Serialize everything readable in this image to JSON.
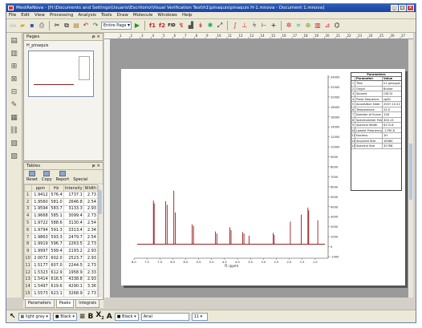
{
  "window": {
    "title": "MestReNova - [H:\\Documents and Settings\\Usuario\\Escritorio\\Visual Verification Test\\h1\\pinaquis\\pinaquis H-1.mnova - Document 1.mnova]"
  },
  "menu": [
    "File",
    "Edit",
    "View",
    "Processing",
    "Analysis",
    "Tools",
    "Draw",
    "Molecule",
    "Windows",
    "Help"
  ],
  "toolbar": {
    "page_select": "Entire Page"
  },
  "pages_panel": {
    "title": "Pages",
    "item_label": "H_pinaquis"
  },
  "tables_panel": {
    "title": "Tables",
    "tools": [
      "Reset",
      "Copy",
      "Report",
      "Special"
    ],
    "columns": [
      "ppm",
      "Hz",
      "Intensity",
      "Width"
    ],
    "rows": [
      [
        "1",
        "1.9412",
        "576.4",
        "1737.1",
        "2.73"
      ],
      [
        "2",
        "1.9560",
        "581.0",
        "2646.8",
        "2.54"
      ],
      [
        "3",
        "1.9594",
        "583.7",
        "3133.3",
        "2.93"
      ],
      [
        "4",
        "1.9668",
        "585.1",
        "3099.4",
        "2.73"
      ],
      [
        "5",
        "1.9722",
        "588.6",
        "3130.4",
        "2.54"
      ],
      [
        "6",
        "1.9794",
        "591.3",
        "3313.4",
        "2.34"
      ],
      [
        "7",
        "1.9863",
        "593.3",
        "2479.7",
        "2.54"
      ],
      [
        "8",
        "1.9919",
        "596.7",
        "2263.5",
        "2.73"
      ],
      [
        "9",
        "1.9997",
        "599.4",
        "2193.2",
        "2.93"
      ],
      [
        "10",
        "2.0072",
        "602.0",
        "2523.7",
        "2.93"
      ],
      [
        "11",
        "1.5177",
        "607.0",
        "2244.5",
        "2.73"
      ],
      [
        "12",
        "1.5323",
        "612.9",
        "1958.9",
        "2.33"
      ],
      [
        "13",
        "1.5414",
        "616.5",
        "4338.8",
        "2.93"
      ],
      [
        "14",
        "1.5497",
        "619.6",
        "4290.1",
        "3.36"
      ],
      [
        "15",
        "1.5573",
        "623.1",
        "3268.9",
        "2.73"
      ]
    ]
  },
  "bottom_tabs": [
    "Parameters",
    "Peaks",
    "Integrals"
  ],
  "statusbar": {
    "fill": "light gray",
    "line": "Black",
    "text_color": "Black",
    "font": "Arial",
    "font_size": "11"
  },
  "ruler_labels": [
    "1",
    "2",
    "3",
    "4",
    "5",
    "6",
    "7",
    "8",
    "9",
    "10",
    "11",
    "12",
    "13",
    "14",
    "15",
    "16",
    "17",
    "18",
    "19",
    "20",
    "21",
    "22",
    "23",
    "24",
    "25",
    "26",
    "27"
  ],
  "chart_data": {
    "type": "line",
    "xlabel": "f1 (ppm)",
    "x_reversed": true,
    "xlim": [
      8.0,
      0.5
    ],
    "x_ticks": [
      "8.0",
      "7.5",
      "7.0",
      "6.5",
      "6.0",
      "5.5",
      "5.0",
      "4.5",
      "4.0",
      "3.5",
      "3.0",
      "2.5",
      "2.0",
      "1.5",
      "1.0"
    ],
    "ylim": [
      -2000,
      24000
    ],
    "y_ticks": [
      "24000",
      "22000",
      "20000",
      "18000",
      "16000",
      "14000",
      "12000",
      "10000",
      "9000",
      "8000",
      "7000",
      "6000",
      "5000",
      "4000",
      "3000",
      "2000",
      "1000",
      "0",
      "-1000"
    ],
    "line_color": "#8b0000",
    "peaks": [
      {
        "x": 7.25,
        "y": 6200
      },
      {
        "x": 7.22,
        "y": 5800
      },
      {
        "x": 6.78,
        "y": 6100
      },
      {
        "x": 6.72,
        "y": 5600
      },
      {
        "x": 6.46,
        "y": 7600
      },
      {
        "x": 6.4,
        "y": 4500
      },
      {
        "x": 5.75,
        "y": 2800
      },
      {
        "x": 5.7,
        "y": 2600
      },
      {
        "x": 4.85,
        "y": 1800
      },
      {
        "x": 4.8,
        "y": 1500
      },
      {
        "x": 4.3,
        "y": 2400
      },
      {
        "x": 4.25,
        "y": 2000
      },
      {
        "x": 3.8,
        "y": 1700
      },
      {
        "x": 3.75,
        "y": 1500
      },
      {
        "x": 3.55,
        "y": 1200
      },
      {
        "x": 2.62,
        "y": 1600
      },
      {
        "x": 2.58,
        "y": 1300
      },
      {
        "x": 1.96,
        "y": 3200
      },
      {
        "x": 1.54,
        "y": 4200
      },
      {
        "x": 1.28,
        "y": 5200
      },
      {
        "x": 1.25,
        "y": 4800
      },
      {
        "x": 0.9,
        "y": 3400
      }
    ]
  },
  "parameters_table": {
    "title": "Parameters",
    "columns": [
      "Parameter",
      "Value"
    ],
    "rows": [
      [
        "1",
        "Title",
        "h1 pinaquis"
      ],
      [
        "2",
        "Origin",
        "Bruker"
      ],
      [
        "3",
        "Solvent",
        "CDCl3"
      ],
      [
        "4",
        "Pulse Sequence",
        "zg30"
      ],
      [
        "5",
        "Acquisition Date",
        "2007-10-22"
      ],
      [
        "6",
        "Temperature",
        "25.0"
      ],
      [
        "7",
        "Number of Scans",
        "128"
      ],
      [
        "8",
        "Spectrometer Frequency",
        "300.13"
      ],
      [
        "9",
        "Spectral Width",
        "6172.8"
      ],
      [
        "10",
        "Lowest Frequency",
        "-1790.8"
      ],
      [
        "11",
        "Nucleus",
        "1H"
      ],
      [
        "12",
        "Acquired Size",
        "16384"
      ],
      [
        "13",
        "Spectral Size",
        "32768"
      ]
    ]
  }
}
